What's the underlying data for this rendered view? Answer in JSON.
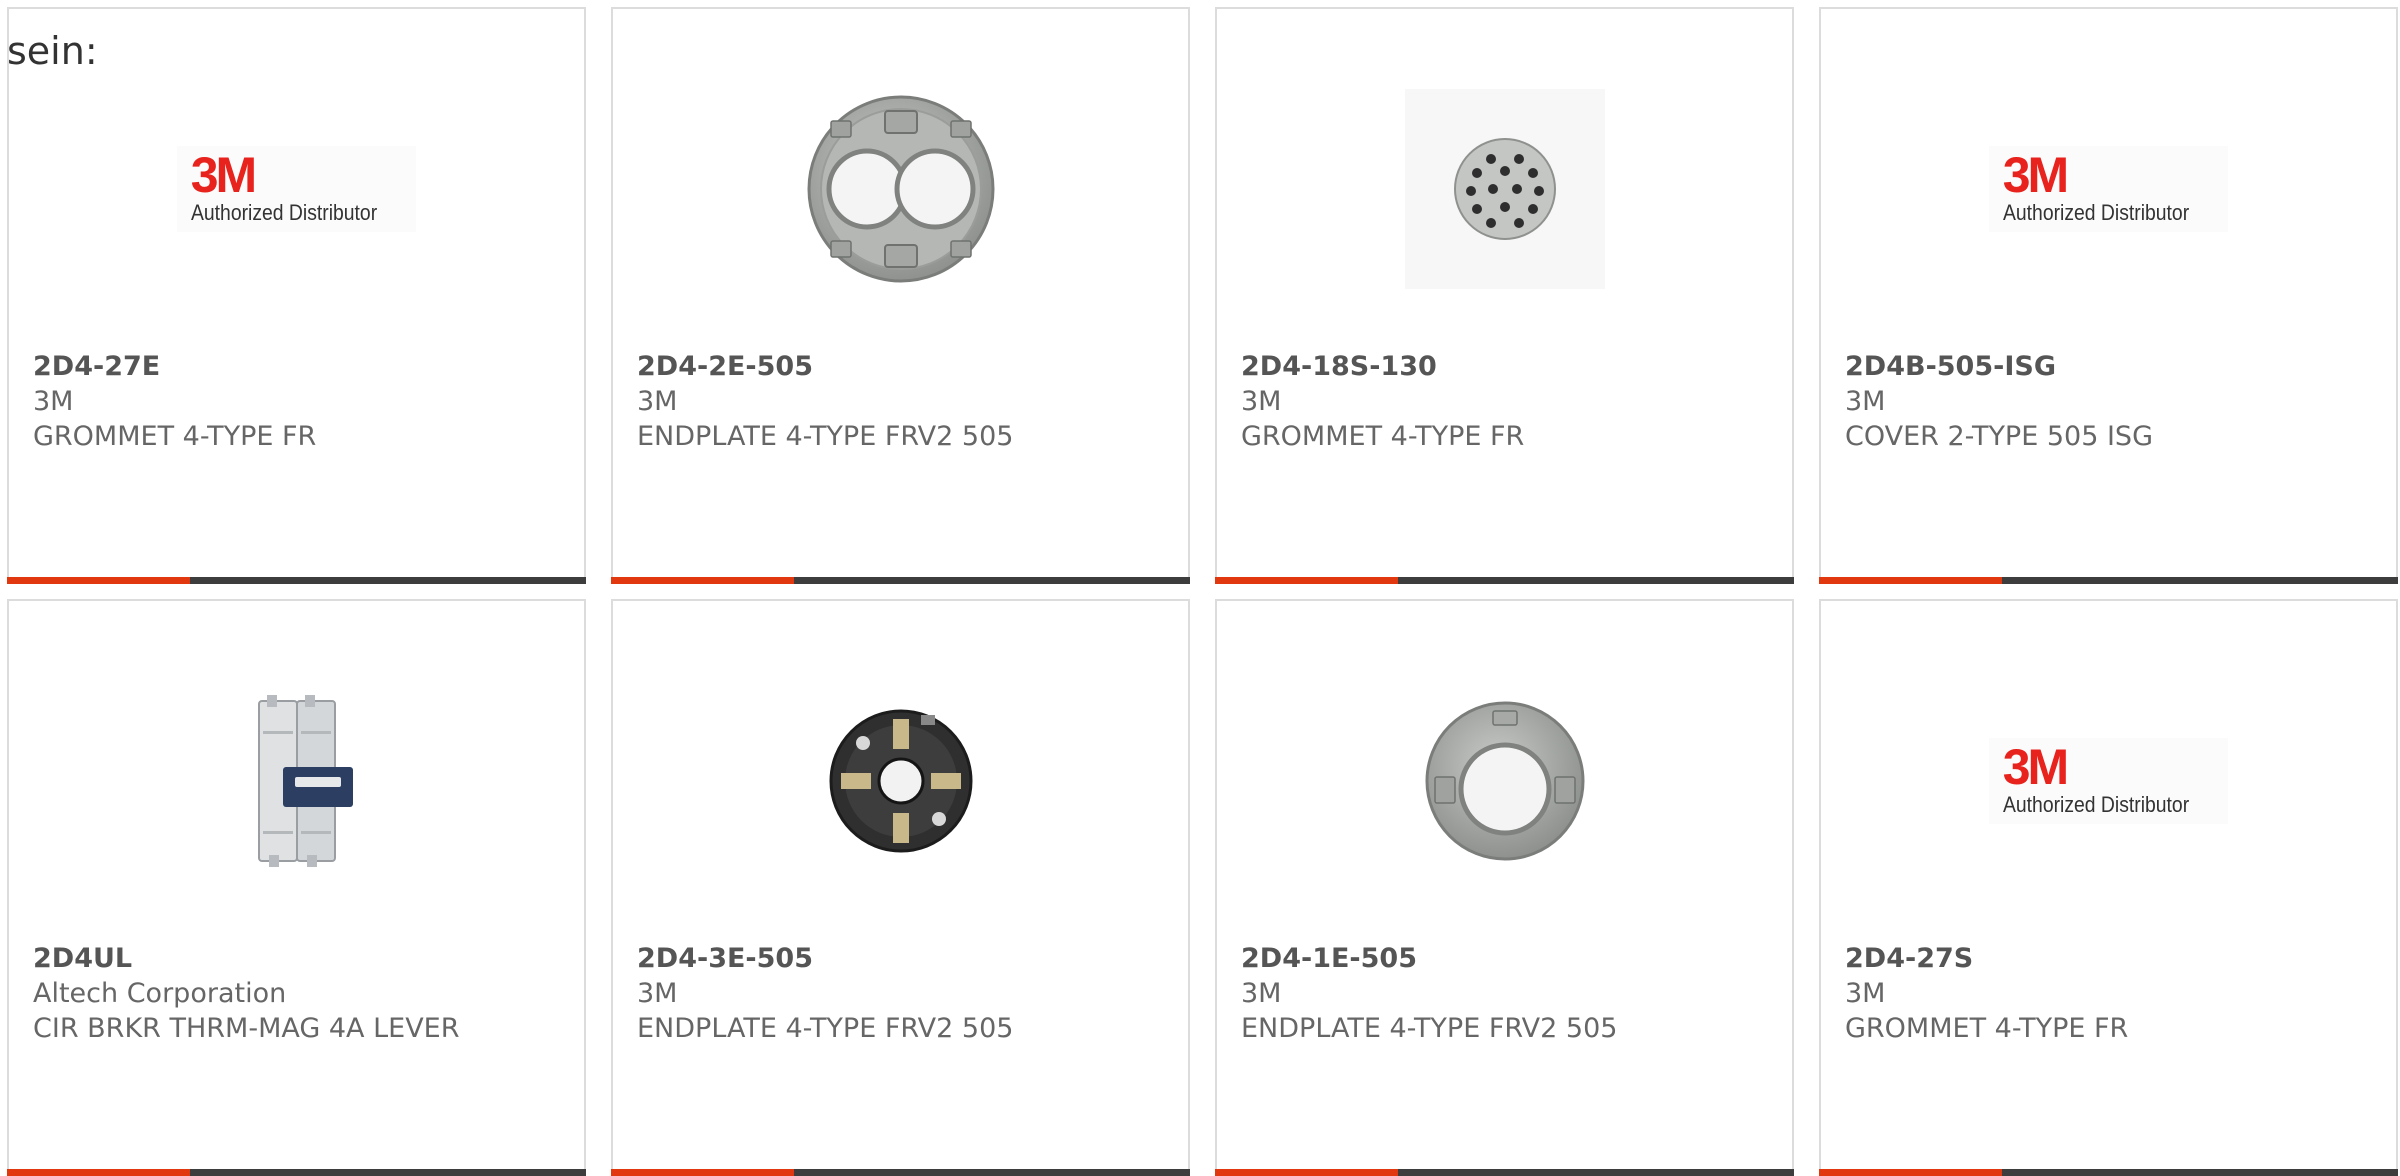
{
  "intro_text": "sein:",
  "colors": {
    "accent_bar": "#e1380f",
    "dark_bar": "#3d3d3d",
    "logo_red": "#e8221c"
  },
  "products": [
    {
      "part_number": "2D4-27E",
      "manufacturer": "3M",
      "description": "GROMMET 4-TYPE FR",
      "image": "3m-authorized-distributor-logo",
      "logo_mark": "3M",
      "logo_text": "Authorized Distributor"
    },
    {
      "part_number": "2D4-2E-505",
      "manufacturer": "3M",
      "description": "ENDPLATE 4-TYPE FRV2 505",
      "image": "endplate-two-hole-photo"
    },
    {
      "part_number": "2D4-18S-130",
      "manufacturer": "3M",
      "description": "GROMMET 4-TYPE FR",
      "image": "grommet-multi-hole-photo"
    },
    {
      "part_number": "2D4B-505-ISG",
      "manufacturer": "3M",
      "description": "COVER 2-TYPE 505 ISG",
      "image": "3m-authorized-distributor-logo",
      "logo_mark": "3M",
      "logo_text": "Authorized Distributor"
    },
    {
      "part_number": "2D4UL",
      "manufacturer": "Altech Corporation",
      "description": "CIR BRKR THRM-MAG 4A LEVER",
      "image": "circuit-breaker-photo"
    },
    {
      "part_number": "2D4-3E-505",
      "manufacturer": "3M",
      "description": "ENDPLATE 4-TYPE FRV2 505",
      "image": "endplate-black-photo"
    },
    {
      "part_number": "2D4-1E-505",
      "manufacturer": "3M",
      "description": "ENDPLATE 4-TYPE FRV2 505",
      "image": "endplate-single-hole-photo"
    },
    {
      "part_number": "2D4-27S",
      "manufacturer": "3M",
      "description": "GROMMET 4-TYPE FR",
      "image": "3m-authorized-distributor-logo",
      "logo_mark": "3M",
      "logo_text": "Authorized Distributor"
    }
  ]
}
